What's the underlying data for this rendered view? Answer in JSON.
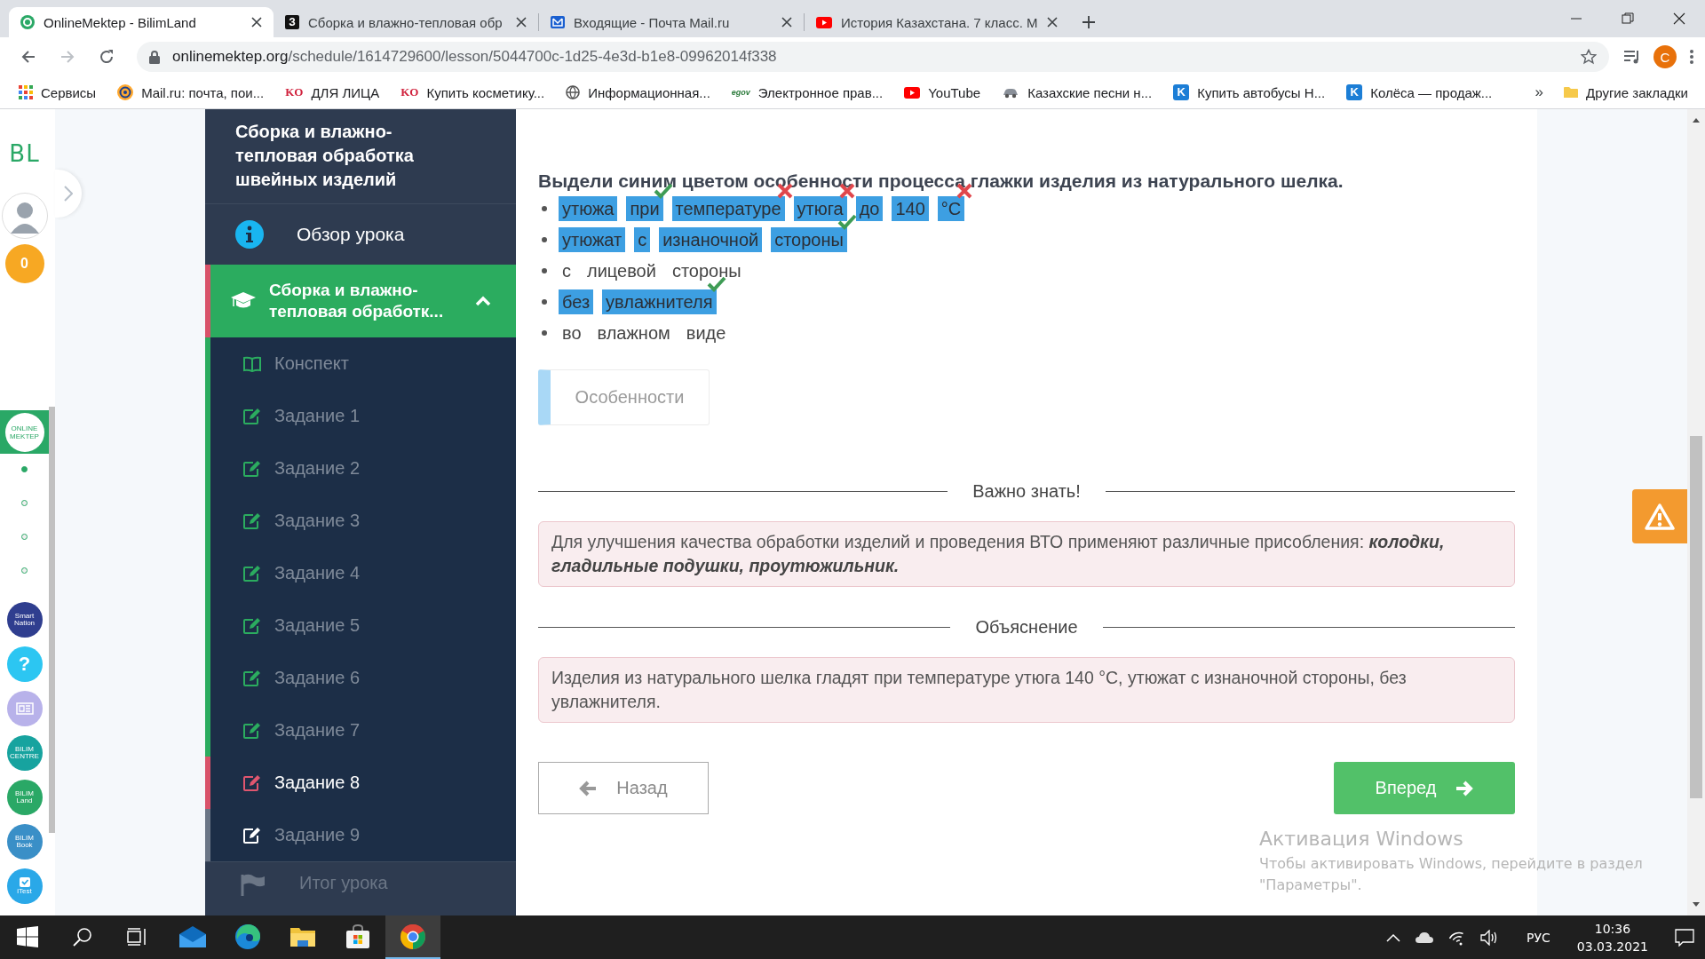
{
  "browser": {
    "tabs": [
      {
        "title": "OnlineMektep - BilimLand",
        "selected": true,
        "kind": "bilimland"
      },
      {
        "title": "Сборка и влажно-тепловая обр",
        "selected": false,
        "kind": "letter",
        "favicon_text": "З"
      },
      {
        "title": "Входящие - Почта Mail.ru",
        "selected": false,
        "kind": "mail"
      },
      {
        "title": "История Казахстана. 7 класс. М",
        "selected": false,
        "kind": "youtube"
      }
    ],
    "forward_disabled": true,
    "url_host": "onlinemektep.org",
    "url_path": "/schedule/1614729600/lesson/5044700c-1d25-4e3d-b1e8-09962014f338",
    "profile_initial": "C",
    "bookmarks": [
      {
        "label": "Сервисы",
        "kind": "apps"
      },
      {
        "label": "Mail.ru: почта, пои...",
        "kind": "at"
      },
      {
        "label": "ДЛЯ ЛИЦА",
        "kind": "text",
        "icon_text": "KO"
      },
      {
        "label": "Купить косметику...",
        "kind": "text",
        "icon_text": "KO"
      },
      {
        "label": "Информационная...",
        "kind": "globe"
      },
      {
        "label": "Электронное прав...",
        "kind": "egov",
        "icon_text": "egov"
      },
      {
        "label": "YouTube",
        "kind": "youtube"
      },
      {
        "label": "Казахские песни н...",
        "kind": "car"
      },
      {
        "label": "Купить автобусы Н...",
        "kind": "k",
        "icon_text": "K"
      },
      {
        "label": "Колёса — продаж...",
        "kind": "k",
        "icon_text": "K"
      }
    ],
    "bookmarks_more": "»",
    "other_bookmarks": "Другие закладки"
  },
  "rail": {
    "logo": "BL",
    "badge": "0",
    "home": {
      "text": "ONLINE MEKTEP",
      "selected": true
    },
    "dots": [
      {
        "selected": true
      },
      {
        "selected": false
      },
      {
        "selected": false
      },
      {
        "selected": false
      }
    ],
    "apps": [
      {
        "kind": "logo",
        "text": "Smart Nation",
        "color": "#2f3e8f"
      },
      {
        "kind": "logo",
        "text": "?",
        "color": "#2cc6f2"
      },
      {
        "kind": "news",
        "color": "#b8b2ea"
      },
      {
        "kind": "logo",
        "text": "BILIM CENTRE",
        "color": "#17a39f"
      },
      {
        "kind": "logo",
        "text": "BILIM Land",
        "color": "#2aa866"
      },
      {
        "kind": "logo",
        "text": "BILIM Book",
        "color": "#3a8fc7"
      },
      {
        "kind": "check",
        "text": "iTest",
        "color": "#2aa8e8"
      }
    ]
  },
  "sidebar": {
    "title": "Сборка и влажно-тепловая обработка швейных изделий",
    "overview": "Обзор урока",
    "section": {
      "label": "Сборка и влажно-тепловая обработк...",
      "expanded": true
    },
    "items": [
      {
        "label": "Конспект",
        "kind": "notes",
        "completed": true,
        "selected": false
      },
      {
        "label": "Задание 1",
        "kind": "task",
        "completed": true,
        "selected": false
      },
      {
        "label": "Задание 2",
        "kind": "task",
        "completed": true,
        "selected": false
      },
      {
        "label": "Задание 3",
        "kind": "task",
        "completed": true,
        "selected": false
      },
      {
        "label": "Задание 4",
        "kind": "task",
        "completed": true,
        "selected": false
      },
      {
        "label": "Задание 5",
        "kind": "task",
        "completed": true,
        "selected": false
      },
      {
        "label": "Задание 6",
        "kind": "task",
        "completed": true,
        "selected": false
      },
      {
        "label": "Задание 7",
        "kind": "task",
        "completed": true,
        "selected": false
      },
      {
        "label": "Задание 8",
        "kind": "task",
        "completed": false,
        "selected": true
      },
      {
        "label": "Задание 9",
        "kind": "task",
        "completed": false,
        "selected": false
      }
    ],
    "summary": "Итог урока"
  },
  "task": {
    "prompt": "Выдели синим цветом особенности процесса глажки изделия из натурального шелка.",
    "items": [
      {
        "words": [
          {
            "text": "утюжа",
            "selected": true
          },
          {
            "text": "при",
            "selected": true,
            "correct": true
          },
          {
            "text": "температуре",
            "selected": true,
            "correct": false
          },
          {
            "text": "утюга",
            "selected": true,
            "correct": false
          },
          {
            "text": "до",
            "selected": true
          },
          {
            "text": "140",
            "selected": true
          },
          {
            "text": "°C",
            "selected": true,
            "correct": false
          }
        ]
      },
      {
        "words": [
          {
            "text": "утюжат",
            "selected": true
          },
          {
            "text": "с",
            "selected": true
          },
          {
            "text": "изнаночной",
            "selected": true
          },
          {
            "text": "стороны",
            "selected": true,
            "correct": true
          }
        ]
      },
      {
        "words": [
          {
            "text": "с",
            "selected": false
          },
          {
            "text": "лицевой",
            "selected": false
          },
          {
            "text": "стороны",
            "selected": false
          }
        ]
      },
      {
        "words": [
          {
            "text": "без",
            "selected": true
          },
          {
            "text": "увлажнителя",
            "selected": true,
            "correct": true
          }
        ]
      },
      {
        "words": [
          {
            "text": "во",
            "selected": false
          },
          {
            "text": "влажном",
            "selected": false
          },
          {
            "text": "виде",
            "selected": false
          }
        ]
      }
    ],
    "category": "Особенности",
    "sections": [
      {
        "heading": "Важно знать!",
        "text": "Для улучшения качества обработки изделий и проведения ВТО применяют различные присобления: **колодки, гладильные подушки, проутюжильник.**"
      },
      {
        "heading": "Объяснение",
        "text": "Изделия из натурального шелка гладят при температуре утюга 140 °C, утюжат с изнаночной стороны, без увлажнителя."
      }
    ],
    "back": "Назад",
    "next": "Вперед"
  },
  "os_notice": {
    "title": "Активация Windows",
    "text": "Чтобы активировать Windows, перейдите в раздел \"Параметры\"."
  },
  "taskbar": {
    "apps": [
      {
        "kind": "start",
        "selected": false
      },
      {
        "kind": "search",
        "selected": false
      },
      {
        "kind": "taskview",
        "selected": false
      },
      {
        "kind": "mail",
        "selected": false
      },
      {
        "kind": "edge",
        "selected": false
      },
      {
        "kind": "explorer",
        "selected": false
      },
      {
        "kind": "store",
        "selected": false
      },
      {
        "kind": "chrome",
        "selected": true
      }
    ],
    "language": "РУС",
    "time": "10:36",
    "date": "03.03.2021"
  }
}
